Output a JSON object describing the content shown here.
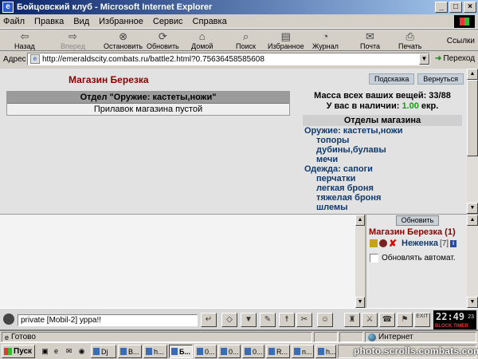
{
  "window": {
    "title": "Бойцовский клуб - Microsoft Internet Explorer",
    "icon": "ie-page-icon",
    "controls": [
      "_",
      "□",
      "×"
    ]
  },
  "menu": [
    "Файл",
    "Правка",
    "Вид",
    "Избранное",
    "Сервис",
    "Справка"
  ],
  "toolbar": {
    "back": "Назад",
    "forward": "Вперед",
    "stop": "Остановить",
    "refresh": "Обновить",
    "home": "Домой",
    "search": "Поиск",
    "favorites": "Избранное",
    "history": "Журнал",
    "mail": "Почта",
    "print": "Печать",
    "links": "Ссылки"
  },
  "address": {
    "label": "Адрес",
    "url": "http://emeraldscity.combats.ru/battle2.html?0.75636458585608",
    "go": "Переход"
  },
  "shop": {
    "title": "Магазин Березка",
    "hint_link": "Подсказка",
    "return_link": "Вернуться",
    "department_header": "Отдел \"Оружие: кастеты,ножи\"",
    "department_empty": "Прилавок магазина пустой",
    "mass_label": "Масса всех ваших вещей: 33/88",
    "money_prefix": "У вас в наличии:",
    "money_amount": "1.00",
    "money_suffix": "екр.",
    "departments_title": "Отделы магазина",
    "departments": [
      {
        "label": "Оружие: кастеты,ножи",
        "sub": false
      },
      {
        "label": "топоры",
        "sub": true
      },
      {
        "label": "дубины,булавы",
        "sub": true
      },
      {
        "label": "мечи",
        "sub": true
      },
      {
        "label": "Одежда: сапоги",
        "sub": false
      },
      {
        "label": "перчатки",
        "sub": true
      },
      {
        "label": "легкая броня",
        "sub": true
      },
      {
        "label": "тяжелая броня",
        "sub": true
      },
      {
        "label": "шлемы",
        "sub": true
      }
    ]
  },
  "users_panel": {
    "refresh": "Обновить",
    "room": "Магазин Березка (1)",
    "user_nick": "Неженка",
    "user_level": "[7]",
    "info_icon": "i",
    "auto_refresh": "Обновлять автомат."
  },
  "chatbar": {
    "input_value": "private [Mobil-2] уррa!!",
    "clock_time": "22:49",
    "clock_seconds": "23",
    "clock_label": "BLOCK TIMER",
    "exit": "EXIT"
  },
  "status": {
    "left": "Готово",
    "zone": "Интернет"
  },
  "taskbar": {
    "start": "Пуск",
    "tasks": [
      "Dj",
      "B...",
      "h...",
      "Б...",
      "0...",
      "0...",
      "0...",
      "R...",
      "n...",
      "h..."
    ],
    "watermark": "photo.scrolls.combats.com"
  },
  "colors": {
    "title_gradient_start": "#0a246a",
    "shop_title": "#8b0000",
    "link_blue": "#103a6e",
    "money_green": "#1a9a1a"
  }
}
